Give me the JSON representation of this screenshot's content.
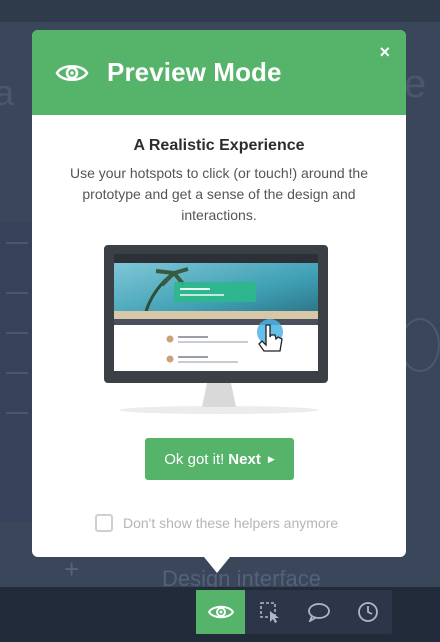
{
  "background": {
    "ghost_left": "a",
    "ghost_right": "e",
    "ghost_bottom": "Design interface",
    "plus": "+"
  },
  "modal": {
    "title": "Preview Mode",
    "close_label": "×",
    "header_icon": "eye-icon",
    "section_title": "A Realistic Experience",
    "description": "Use your hotspots to click (or touch!) around the prototype and get a sense of the design and interactions.",
    "cta": {
      "light": "Ok got it!",
      "bold": "Next",
      "arrow": "▶"
    },
    "helper_checkbox": {
      "label": "Don't show these helpers anymore",
      "checked": false
    }
  },
  "toolbar": {
    "items": [
      {
        "icon": "eye-icon",
        "active": true
      },
      {
        "icon": "hotspot-select-icon",
        "active": false
      },
      {
        "icon": "comment-icon",
        "active": false
      },
      {
        "icon": "history-clock-icon",
        "active": false
      }
    ]
  },
  "colors": {
    "accent": "#56b36a",
    "overlay": "#3a4659",
    "toolbar": "#2c3648"
  }
}
